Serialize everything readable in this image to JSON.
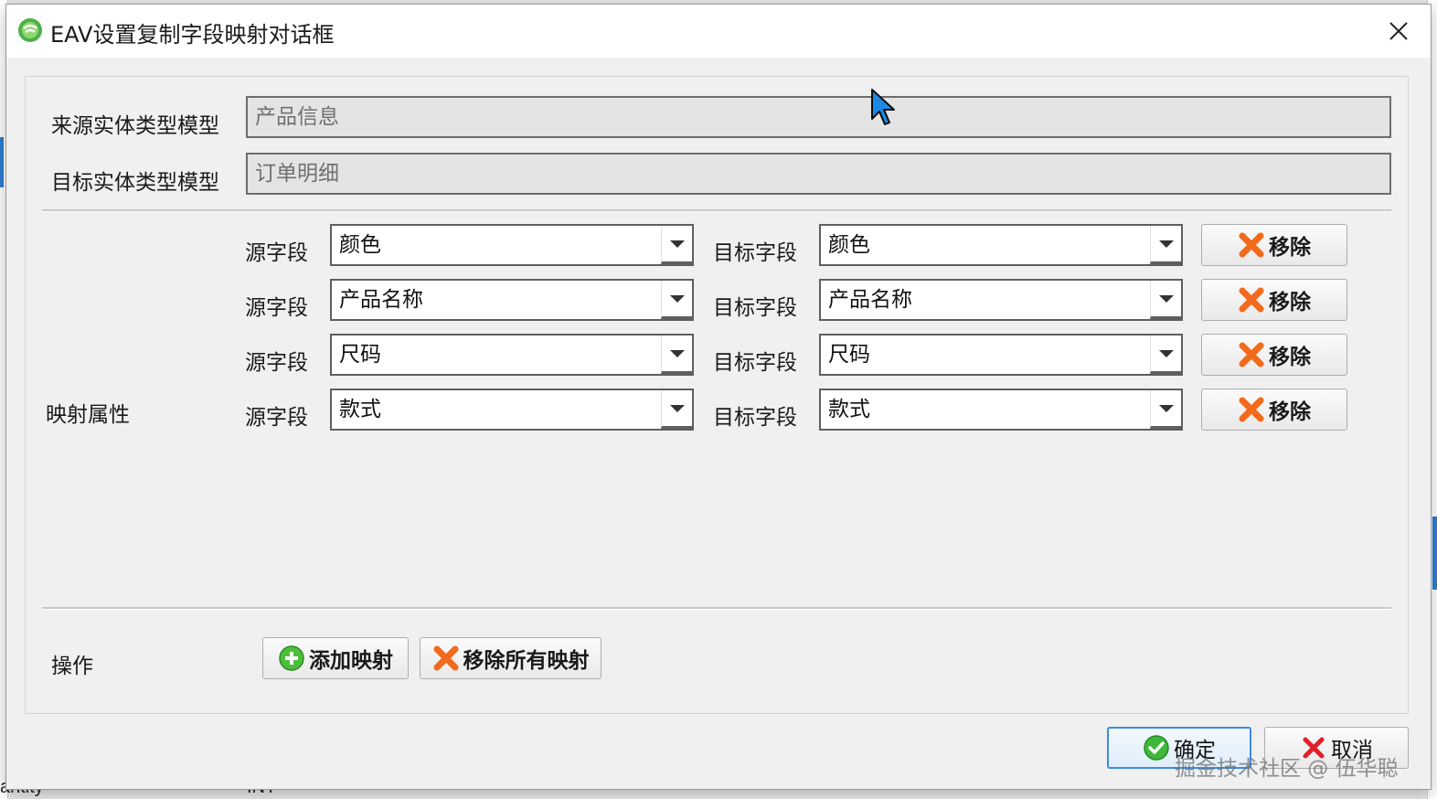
{
  "dialog": {
    "title": "EAV设置复制字段映射对话框",
    "close_label": "✕"
  },
  "source_model": {
    "label": "来源实体类型模型",
    "value": "产品信息"
  },
  "target_model": {
    "label": "目标实体类型模型",
    "value": "订单明细"
  },
  "mapping": {
    "label": "映射属性",
    "source_label": "源字段",
    "target_label": "目标字段",
    "remove_label": "移除",
    "rows": [
      {
        "source": "颜色",
        "target": "颜色"
      },
      {
        "source": "产品名称",
        "target": "产品名称"
      },
      {
        "source": "尺码",
        "target": "尺码"
      },
      {
        "source": "款式",
        "target": "款式"
      }
    ]
  },
  "actions": {
    "label": "操作",
    "add_label": "添加映射",
    "remove_all_label": "移除所有映射"
  },
  "footer": {
    "ok_label": "确定",
    "cancel_label": "取消"
  },
  "watermark": "掘金技术社区 @ 伍华聪",
  "background": {
    "bottom_left": "antity",
    "bottom_mid": "INT"
  },
  "colors": {
    "accent_blue": "#3c8de0",
    "remove_icon": "#f26a1b",
    "add_icon": "#4cbf3a",
    "cancel_icon": "#e0202a"
  }
}
